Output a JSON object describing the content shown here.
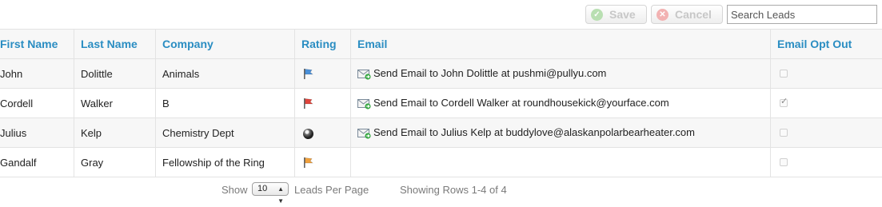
{
  "toolbar": {
    "save_label": "Save",
    "cancel_label": "Cancel",
    "search_placeholder": "Search Leads"
  },
  "table": {
    "columns": [
      "First Name",
      "Last Name",
      "Company",
      "Rating",
      "Email",
      "Email Opt Out"
    ],
    "rows": [
      {
        "first": "John",
        "last": "Dolittle",
        "company": "Animals",
        "rating": "blue-flag-icon",
        "email": "Send Email to John Dolittle at pushmi@pullyu.com",
        "opt_out": false
      },
      {
        "first": "Cordell",
        "last": "Walker",
        "company": "B",
        "rating": "red-flag-icon",
        "email": "Send Email to Cordell Walker at roundhousekick@yourface.com",
        "opt_out": true
      },
      {
        "first": "Julius",
        "last": "Kelp",
        "company": "Chemistry Dept",
        "rating": "eight-ball-icon",
        "email": "Send Email to Julius Kelp at buddylove@alaskanpolarbearheater.com",
        "opt_out": false
      },
      {
        "first": "Gandalf",
        "last": "Gray",
        "company": "Fellowship of the Ring",
        "rating": "orange-flag-icon",
        "email": "",
        "opt_out": false
      }
    ]
  },
  "footer": {
    "show_label": "Show",
    "per_page_value": "10",
    "per_page_label": "Leads Per Page",
    "showing_rows": "Showing Rows 1-4 of 4"
  },
  "colors": {
    "header_text": "#2a8dc2",
    "flag_blue": "#4a90d9",
    "flag_red": "#e0443c",
    "flag_orange": "#f0a03c"
  }
}
